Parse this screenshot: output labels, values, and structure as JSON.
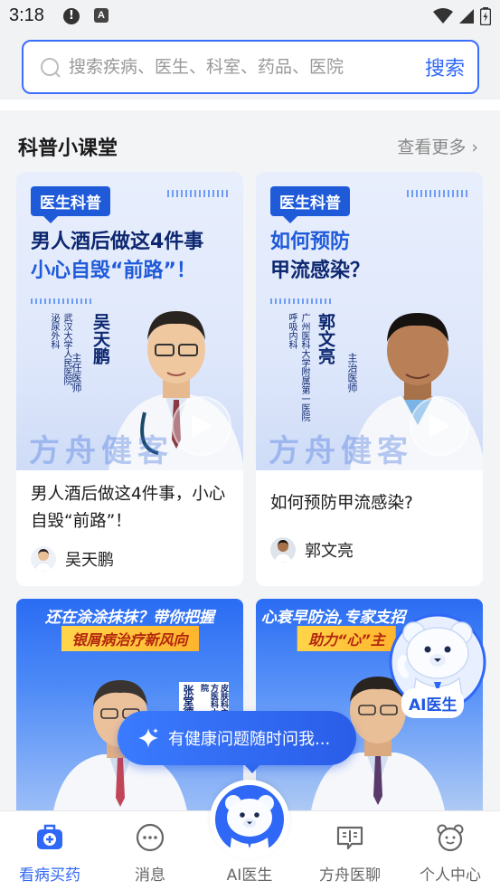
{
  "status_bar": {
    "time": "3:18",
    "alert_glyph": "!",
    "notif_glyph": "A"
  },
  "search": {
    "placeholder": "搜索疾病、医生、科室、药品、医院",
    "button_label": "搜索"
  },
  "section": {
    "title": "科普小课堂",
    "more_label": "查看更多",
    "more_glyph": "›"
  },
  "cards": [
    {
      "tag": "医生科普",
      "headline_line1": "男人酒后做这4件事",
      "headline_line2": "小心自毁“前路”！",
      "doctor_name": "吴天鹏",
      "doctor_title": "主任医师",
      "hospital": "武汉大学人民医院",
      "department": "泌尿外科",
      "brand_watermark": "方舟健客",
      "title": "男人酒后做这4件事，小心自毁“前路”！",
      "author": "吴天鹏"
    },
    {
      "tag": "医生科普",
      "headline_line1": "如何预防",
      "headline_line2": "甲流感染？",
      "doctor_name": "郭文亮",
      "doctor_title": "主治医师",
      "hospital": "广州医科大学附属第一医院",
      "department": "呼吸内科",
      "brand_watermark": "方舟健客",
      "title": "如何预防甲流感染?",
      "author": "郭文亮"
    }
  ],
  "banners": [
    {
      "line1": "还在涂涂抹抹？带你把握",
      "line2": "银屑病治疗新风向",
      "doctor_name": "张堂德",
      "doctor_role": "教授",
      "hospital": "皮肤科主任医师 南方医科大学珠江医院"
    },
    {
      "line1": "心衰早防治,专家支招",
      "line2": "助力“心”主"
    }
  ],
  "ai_float": {
    "label": "AI医生"
  },
  "ai_prompt": {
    "text": "有健康问题随时问我..."
  },
  "tabs": [
    {
      "label": "看病买药",
      "icon": "medkit-icon",
      "active": true
    },
    {
      "label": "消息",
      "icon": "message-icon",
      "active": false
    },
    {
      "label": "AI医生",
      "icon": "ai-doctor-icon",
      "active": false
    },
    {
      "label": "方舟医聊",
      "icon": "chat-book-icon",
      "active": false
    },
    {
      "label": "个人中心",
      "icon": "bear-face-icon",
      "active": false
    }
  ],
  "colors": {
    "accent": "#2f67f6",
    "navy": "#0d2770",
    "tag_blue": "#1f5ad9"
  }
}
